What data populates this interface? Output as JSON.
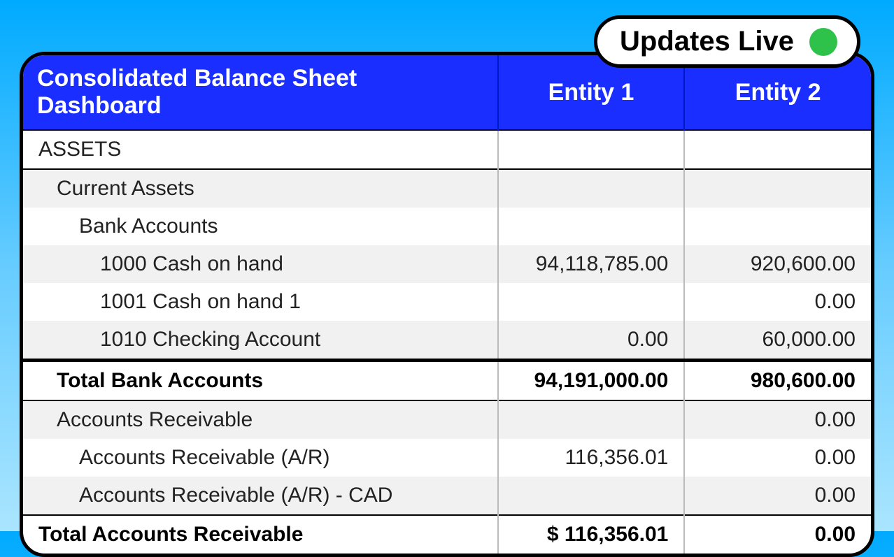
{
  "status": {
    "label": "Updates Live"
  },
  "table": {
    "headers": [
      "Consolidated Balance Sheet Dashboard",
      "Entity 1",
      "Entity 2"
    ],
    "rows": [
      {
        "label": "ASSETS",
        "e1": "",
        "e2": "",
        "indent": 0,
        "bold": false,
        "shade": false,
        "sep": "single"
      },
      {
        "label": "Current Assets",
        "e1": "",
        "e2": "",
        "indent": 1,
        "bold": false,
        "shade": true,
        "sep": "single"
      },
      {
        "label": "Bank Accounts",
        "e1": "",
        "e2": "",
        "indent": 2,
        "bold": false,
        "shade": false,
        "sep": ""
      },
      {
        "label": "1000 Cash on hand",
        "e1": "94,118,785.00",
        "e2": "920,600.00",
        "indent": 3,
        "bold": false,
        "shade": true,
        "sep": ""
      },
      {
        "label": "1001 Cash on hand 1",
        "e1": "",
        "e2": "0.00",
        "indent": 3,
        "bold": false,
        "shade": false,
        "sep": ""
      },
      {
        "label": "1010 Checking Account",
        "e1": "0.00",
        "e2": "60,000.00",
        "indent": 3,
        "bold": false,
        "shade": true,
        "sep": ""
      },
      {
        "label": "Total Bank Accounts",
        "e1": "94,191,000.00",
        "e2": "980,600.00",
        "indent": 1,
        "bold": true,
        "shade": false,
        "sep": "double"
      },
      {
        "label": "Accounts Receivable",
        "e1": "",
        "e2": "0.00",
        "indent": 1,
        "bold": false,
        "shade": true,
        "sep": "single"
      },
      {
        "label": "Accounts Receivable (A/R)",
        "e1": "116,356.01",
        "e2": "0.00",
        "indent": 2,
        "bold": false,
        "shade": false,
        "sep": ""
      },
      {
        "label": "Accounts Receivable (A/R) - CAD",
        "e1": "",
        "e2": "0.00",
        "indent": 2,
        "bold": false,
        "shade": true,
        "sep": ""
      },
      {
        "label": "Total Accounts Receivable",
        "e1": "$ 116,356.01",
        "e2": "0.00",
        "indent": 0,
        "bold": true,
        "shade": false,
        "sep": "single"
      }
    ]
  }
}
